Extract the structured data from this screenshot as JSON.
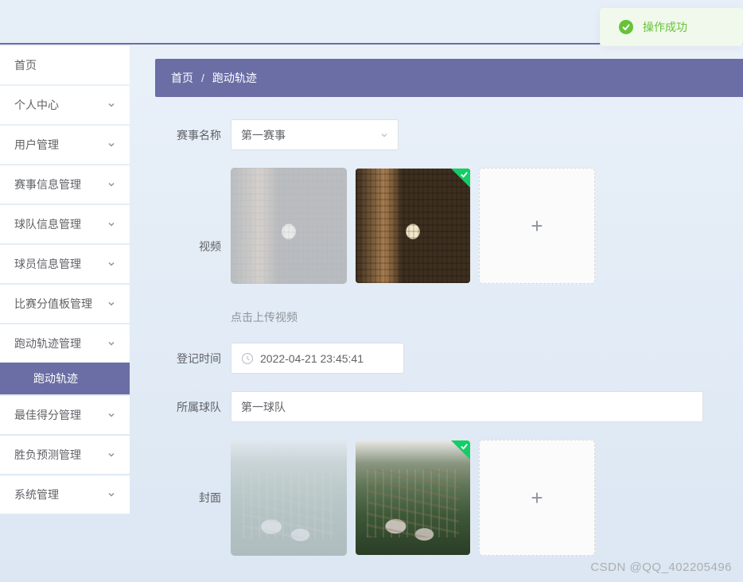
{
  "toast": {
    "text": "操作成功"
  },
  "sidebar": {
    "items": [
      {
        "label": "首页",
        "expandable": false
      },
      {
        "label": "个人中心",
        "expandable": true
      },
      {
        "label": "用户管理",
        "expandable": true
      },
      {
        "label": "赛事信息管理",
        "expandable": true
      },
      {
        "label": "球队信息管理",
        "expandable": true
      },
      {
        "label": "球员信息管理",
        "expandable": true
      },
      {
        "label": "比赛分值板管理",
        "expandable": true
      },
      {
        "label": "跑动轨迹管理",
        "expandable": true,
        "children": [
          {
            "label": "跑动轨迹"
          }
        ]
      },
      {
        "label": "最佳得分管理",
        "expandable": true
      },
      {
        "label": "胜负预测管理",
        "expandable": true
      },
      {
        "label": "系统管理",
        "expandable": true
      }
    ]
  },
  "breadcrumb": {
    "home": "首页",
    "sep": "/",
    "current": "跑动轨迹"
  },
  "form": {
    "event_label": "赛事名称",
    "event_value": "第一赛事",
    "video_label": "视频",
    "video_hint": "点击上传视频",
    "register_time_label": "登记时间",
    "register_time_value": "2022-04-21 23:45:41",
    "team_label": "所属球队",
    "team_value": "第一球队",
    "cover_label": "封面"
  },
  "icons": {
    "plus": "+"
  },
  "watermark": "CSDN @QQ_402205496"
}
